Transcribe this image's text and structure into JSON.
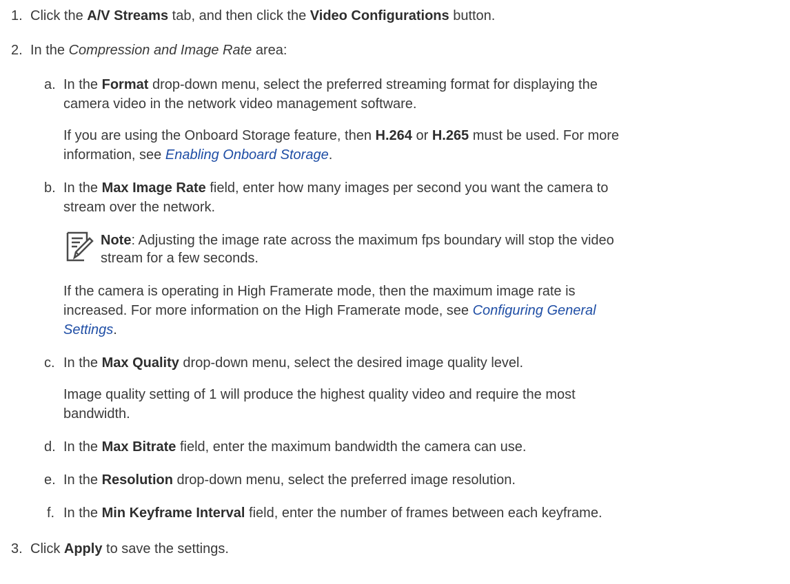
{
  "steps": [
    {
      "num": "1.",
      "pre": "Click the ",
      "b1": "A/V Streams",
      "mid": " tab, and then click the ",
      "b2": "Video Configurations",
      "post": " button."
    },
    {
      "num": "2.",
      "pre": "In the ",
      "em": "Compression and Image Rate",
      "post": " area:"
    },
    {
      "num": "3.",
      "pre": "Click ",
      "b": "Apply",
      "post": " to save the settings."
    }
  ],
  "substeps": {
    "a": {
      "letter": "a.",
      "line1_pre": "In the ",
      "line1_b": "Format",
      "line1_post": " drop-down menu, select the preferred streaming format for displaying the",
      "line2": "camera video in the network video management software.",
      "para_line1_pre": "If you are using the Onboard Storage feature, then ",
      "para_b1": "H.264",
      "para_or": " or ",
      "para_b2": "H.265",
      "para_line1_post": " must be used. For more",
      "para_line2_pre": "information, see ",
      "para_link": "Enabling Onboard Storage",
      "para_line2_post": "."
    },
    "b": {
      "letter": "b.",
      "line1_pre": "In the ",
      "line1_b": "Max Image Rate",
      "line1_post": " field, enter how many images per second you want the camera to",
      "line2": "stream over the network.",
      "note_label": "Note",
      "note_line1": ": Adjusting the image rate across the maximum fps boundary will stop the video",
      "note_line2": "stream for a few seconds.",
      "para_line1": "If the camera is operating in High Framerate mode, then the maximum image rate is",
      "para_line2_pre": "increased. For more information on the High Framerate mode, see ",
      "para_link1": "Configuring General",
      "para_link2": "Settings",
      "para_line3_post": "."
    },
    "c": {
      "letter": "c.",
      "pre": "In the ",
      "b": "Max Quality",
      "post": " drop-down menu, select the desired image quality level.",
      "para_line1": "Image quality setting of 1 will produce the highest quality video and require the most",
      "para_line2": "bandwidth."
    },
    "d": {
      "letter": "d.",
      "pre": "In the ",
      "b": "Max Bitrate",
      "post": " field, enter the maximum bandwidth the camera can use."
    },
    "e": {
      "letter": "e.",
      "pre": "In the ",
      "b": "Resolution",
      "post": " drop-down menu, select the preferred image resolution."
    },
    "f": {
      "letter": "f.",
      "pre": "In the ",
      "b": "Min Keyframe Interval",
      "post": " field, enter the number of frames between each keyframe."
    }
  },
  "icons": {
    "note": "note-edit-icon"
  },
  "colors": {
    "text": "#3a3a3a",
    "link": "#1f4ea5"
  }
}
